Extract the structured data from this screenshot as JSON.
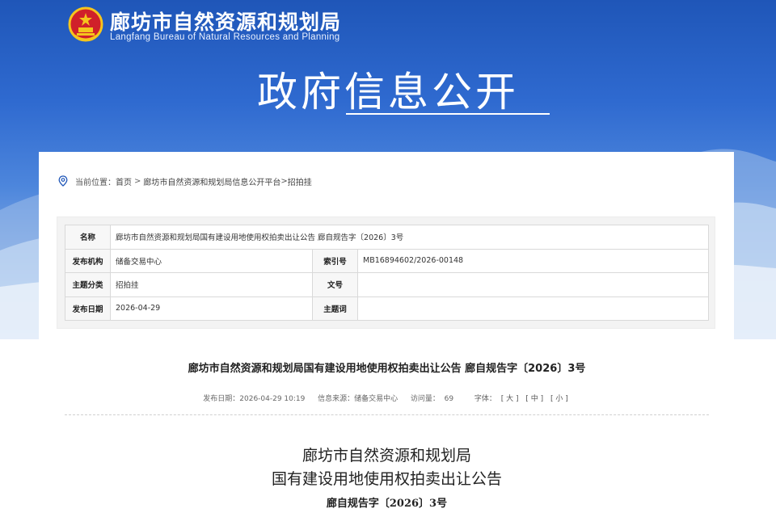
{
  "header": {
    "site_title": "廊坊市自然资源和规划局",
    "site_subtitle": "Langfang Bureau of Natural Resources and Planning",
    "banner_title": "政府信息公开"
  },
  "breadcrumb": {
    "label": "当前位置：",
    "items": [
      "首页",
      "廊坊市自然资源和规划局信息公开平台",
      "招拍挂"
    ],
    "separators": [
      " > ",
      ">"
    ]
  },
  "meta_table": {
    "rows": [
      {
        "k1": "名称",
        "v1": "廊坊市自然资源和规划局国有建设用地使用权拍卖出让公告 廊自规告字〔2026〕3号"
      },
      {
        "k1": "发布机构",
        "v1": "储备交易中心",
        "k2": "索引号",
        "v2": "MB16894602/2026-00148"
      },
      {
        "k1": "主题分类",
        "v1": "招拍挂",
        "k2": "文号",
        "v2": ""
      },
      {
        "k1": "发布日期",
        "v1": "2026-04-29",
        "k2": "主题词",
        "v2": ""
      }
    ]
  },
  "article": {
    "title": "廊坊市自然资源和规划局国有建设用地使用权拍卖出让公告 廊自规告字〔2026〕3号",
    "info": {
      "date_label": "发布日期：",
      "date": "2026-04-29 10:19",
      "source_label": "信息来源：",
      "source": "储备交易中心",
      "views_label": "访问量：",
      "views": "69",
      "font_label": "字体：",
      "font_large": "[ 大 ]",
      "font_medium": "[ 中 ]",
      "font_small": "[ 小 ]"
    },
    "doc_line1": "廊坊市自然资源和规划局",
    "doc_line2": "国有建设用地使用权拍卖出让公告",
    "doc_line3": "廊自规告字〔2026〕3号"
  },
  "colors": {
    "banner_top": "#1f56b8",
    "banner_bottom": "#eef3fb",
    "emblem_red": "#d0202a",
    "emblem_gold": "#f5c51d"
  }
}
